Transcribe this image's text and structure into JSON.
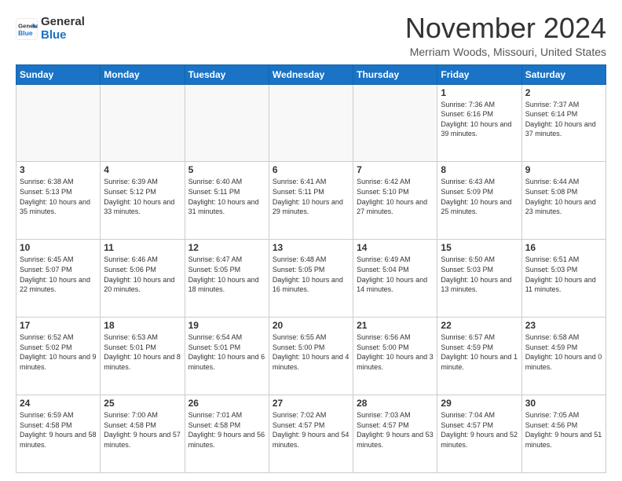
{
  "header": {
    "logo_line1": "General",
    "logo_line2": "Blue",
    "month": "November 2024",
    "location": "Merriam Woods, Missouri, United States"
  },
  "days_of_week": [
    "Sunday",
    "Monday",
    "Tuesday",
    "Wednesday",
    "Thursday",
    "Friday",
    "Saturday"
  ],
  "weeks": [
    [
      {
        "day": "",
        "empty": true
      },
      {
        "day": "",
        "empty": true
      },
      {
        "day": "",
        "empty": true
      },
      {
        "day": "",
        "empty": true
      },
      {
        "day": "",
        "empty": true
      },
      {
        "day": "1",
        "sunrise": "Sunrise: 7:36 AM",
        "sunset": "Sunset: 6:16 PM",
        "daylight": "Daylight: 10 hours and 39 minutes."
      },
      {
        "day": "2",
        "sunrise": "Sunrise: 7:37 AM",
        "sunset": "Sunset: 6:14 PM",
        "daylight": "Daylight: 10 hours and 37 minutes."
      }
    ],
    [
      {
        "day": "3",
        "sunrise": "Sunrise: 6:38 AM",
        "sunset": "Sunset: 5:13 PM",
        "daylight": "Daylight: 10 hours and 35 minutes."
      },
      {
        "day": "4",
        "sunrise": "Sunrise: 6:39 AM",
        "sunset": "Sunset: 5:12 PM",
        "daylight": "Daylight: 10 hours and 33 minutes."
      },
      {
        "day": "5",
        "sunrise": "Sunrise: 6:40 AM",
        "sunset": "Sunset: 5:11 PM",
        "daylight": "Daylight: 10 hours and 31 minutes."
      },
      {
        "day": "6",
        "sunrise": "Sunrise: 6:41 AM",
        "sunset": "Sunset: 5:11 PM",
        "daylight": "Daylight: 10 hours and 29 minutes."
      },
      {
        "day": "7",
        "sunrise": "Sunrise: 6:42 AM",
        "sunset": "Sunset: 5:10 PM",
        "daylight": "Daylight: 10 hours and 27 minutes."
      },
      {
        "day": "8",
        "sunrise": "Sunrise: 6:43 AM",
        "sunset": "Sunset: 5:09 PM",
        "daylight": "Daylight: 10 hours and 25 minutes."
      },
      {
        "day": "9",
        "sunrise": "Sunrise: 6:44 AM",
        "sunset": "Sunset: 5:08 PM",
        "daylight": "Daylight: 10 hours and 23 minutes."
      }
    ],
    [
      {
        "day": "10",
        "sunrise": "Sunrise: 6:45 AM",
        "sunset": "Sunset: 5:07 PM",
        "daylight": "Daylight: 10 hours and 22 minutes."
      },
      {
        "day": "11",
        "sunrise": "Sunrise: 6:46 AM",
        "sunset": "Sunset: 5:06 PM",
        "daylight": "Daylight: 10 hours and 20 minutes."
      },
      {
        "day": "12",
        "sunrise": "Sunrise: 6:47 AM",
        "sunset": "Sunset: 5:05 PM",
        "daylight": "Daylight: 10 hours and 18 minutes."
      },
      {
        "day": "13",
        "sunrise": "Sunrise: 6:48 AM",
        "sunset": "Sunset: 5:05 PM",
        "daylight": "Daylight: 10 hours and 16 minutes."
      },
      {
        "day": "14",
        "sunrise": "Sunrise: 6:49 AM",
        "sunset": "Sunset: 5:04 PM",
        "daylight": "Daylight: 10 hours and 14 minutes."
      },
      {
        "day": "15",
        "sunrise": "Sunrise: 6:50 AM",
        "sunset": "Sunset: 5:03 PM",
        "daylight": "Daylight: 10 hours and 13 minutes."
      },
      {
        "day": "16",
        "sunrise": "Sunrise: 6:51 AM",
        "sunset": "Sunset: 5:03 PM",
        "daylight": "Daylight: 10 hours and 11 minutes."
      }
    ],
    [
      {
        "day": "17",
        "sunrise": "Sunrise: 6:52 AM",
        "sunset": "Sunset: 5:02 PM",
        "daylight": "Daylight: 10 hours and 9 minutes."
      },
      {
        "day": "18",
        "sunrise": "Sunrise: 6:53 AM",
        "sunset": "Sunset: 5:01 PM",
        "daylight": "Daylight: 10 hours and 8 minutes."
      },
      {
        "day": "19",
        "sunrise": "Sunrise: 6:54 AM",
        "sunset": "Sunset: 5:01 PM",
        "daylight": "Daylight: 10 hours and 6 minutes."
      },
      {
        "day": "20",
        "sunrise": "Sunrise: 6:55 AM",
        "sunset": "Sunset: 5:00 PM",
        "daylight": "Daylight: 10 hours and 4 minutes."
      },
      {
        "day": "21",
        "sunrise": "Sunrise: 6:56 AM",
        "sunset": "Sunset: 5:00 PM",
        "daylight": "Daylight: 10 hours and 3 minutes."
      },
      {
        "day": "22",
        "sunrise": "Sunrise: 6:57 AM",
        "sunset": "Sunset: 4:59 PM",
        "daylight": "Daylight: 10 hours and 1 minute."
      },
      {
        "day": "23",
        "sunrise": "Sunrise: 6:58 AM",
        "sunset": "Sunset: 4:59 PM",
        "daylight": "Daylight: 10 hours and 0 minutes."
      }
    ],
    [
      {
        "day": "24",
        "sunrise": "Sunrise: 6:59 AM",
        "sunset": "Sunset: 4:58 PM",
        "daylight": "Daylight: 9 hours and 58 minutes."
      },
      {
        "day": "25",
        "sunrise": "Sunrise: 7:00 AM",
        "sunset": "Sunset: 4:58 PM",
        "daylight": "Daylight: 9 hours and 57 minutes."
      },
      {
        "day": "26",
        "sunrise": "Sunrise: 7:01 AM",
        "sunset": "Sunset: 4:58 PM",
        "daylight": "Daylight: 9 hours and 56 minutes."
      },
      {
        "day": "27",
        "sunrise": "Sunrise: 7:02 AM",
        "sunset": "Sunset: 4:57 PM",
        "daylight": "Daylight: 9 hours and 54 minutes."
      },
      {
        "day": "28",
        "sunrise": "Sunrise: 7:03 AM",
        "sunset": "Sunset: 4:57 PM",
        "daylight": "Daylight: 9 hours and 53 minutes."
      },
      {
        "day": "29",
        "sunrise": "Sunrise: 7:04 AM",
        "sunset": "Sunset: 4:57 PM",
        "daylight": "Daylight: 9 hours and 52 minutes."
      },
      {
        "day": "30",
        "sunrise": "Sunrise: 7:05 AM",
        "sunset": "Sunset: 4:56 PM",
        "daylight": "Daylight: 9 hours and 51 minutes."
      }
    ]
  ]
}
